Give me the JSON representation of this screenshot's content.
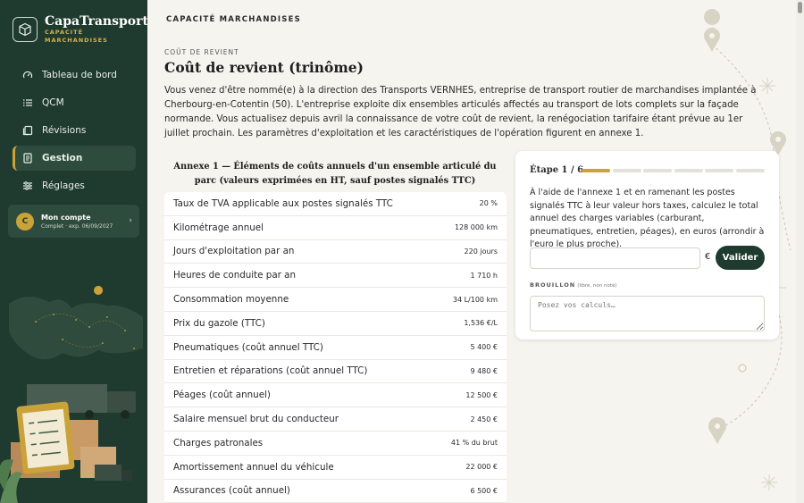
{
  "brand": {
    "name": "CapaTransport",
    "sub1": "CAPACITÉ",
    "sub2": "MARCHANDISES"
  },
  "nav": [
    {
      "label": "Tableau de bord",
      "icon": "gauge-icon"
    },
    {
      "label": "QCM",
      "icon": "list-icon"
    },
    {
      "label": "Révisions",
      "icon": "cards-icon"
    },
    {
      "label": "Gestion",
      "icon": "document-icon",
      "active": true
    },
    {
      "label": "Réglages",
      "icon": "sliders-icon"
    }
  ],
  "account": {
    "initial": "C",
    "name": "Mon compte",
    "status": "Complet · exp. 06/09/2027"
  },
  "topbar": {
    "title": "CAPACITÉ MARCHANDISES"
  },
  "page": {
    "section": "COÛT DE REVIENT",
    "title": "Coût de revient (trinôme)",
    "intro": "Vous venez d'être nommé(e) à la direction des Transports VERNHES, entreprise de transport routier de marchandises implantée à Cherbourg-en-Cotentin (50). L'entreprise exploite dix ensembles articulés affectés au transport de lots complets sur la façade normande. Vous actualisez depuis avril la connaissance de votre coût de revient, la renégociation tarifaire étant prévue au 1er juillet prochain. Les paramètres d'exploitation et les caractéristiques de l'opération figurent en annexe 1."
  },
  "annex": {
    "title": "Annexe 1 — Éléments de coûts annuels d'un ensemble articulé du parc (valeurs exprimées en HT, sauf postes signalés TTC)",
    "rows": [
      {
        "label": "Taux de TVA applicable aux postes signalés TTC",
        "value": "20 %"
      },
      {
        "label": "Kilométrage annuel",
        "value": "128 000 km"
      },
      {
        "label": "Jours d'exploitation par an",
        "value": "220 jours"
      },
      {
        "label": "Heures de conduite par an",
        "value": "1 710 h"
      },
      {
        "label": "Consommation moyenne",
        "value": "34 L/100 km"
      },
      {
        "label": "Prix du gazole (TTC)",
        "value": "1,536 €/L"
      },
      {
        "label": "Pneumatiques (coût annuel TTC)",
        "value": "5 400 €"
      },
      {
        "label": "Entretien et réparations (coût annuel TTC)",
        "value": "9 480 €"
      },
      {
        "label": "Péages (coût annuel)",
        "value": "12 500 €"
      },
      {
        "label": "Salaire mensuel brut du conducteur",
        "value": "2 450 €"
      },
      {
        "label": "Charges patronales",
        "value": "41 % du brut"
      },
      {
        "label": "Amortissement annuel du véhicule",
        "value": "22 000 €"
      },
      {
        "label": "Assurances (coût annuel)",
        "value": "6 500 €"
      }
    ]
  },
  "panel": {
    "step_label": "Étape 1 / 6",
    "step_current": 1,
    "step_total": 6,
    "question": "À l'aide de l'annexe 1 et en ramenant les postes signalés TTC à leur valeur hors taxes, calculez le total annuel des charges variables (carburant, pneumatiques, entretien, péages), en euros (arrondir à l'euro le plus proche).",
    "answer_value": "",
    "currency": "€",
    "validate_label": "Valider",
    "draft_label": "BROUILLON",
    "draft_note": "(libre, non noté)",
    "draft_placeholder": "Posez vos calculs…"
  },
  "colors": {
    "sidebar": "#1f3a2e",
    "accent": "#c9a33a",
    "background": "#f6f4ee"
  }
}
